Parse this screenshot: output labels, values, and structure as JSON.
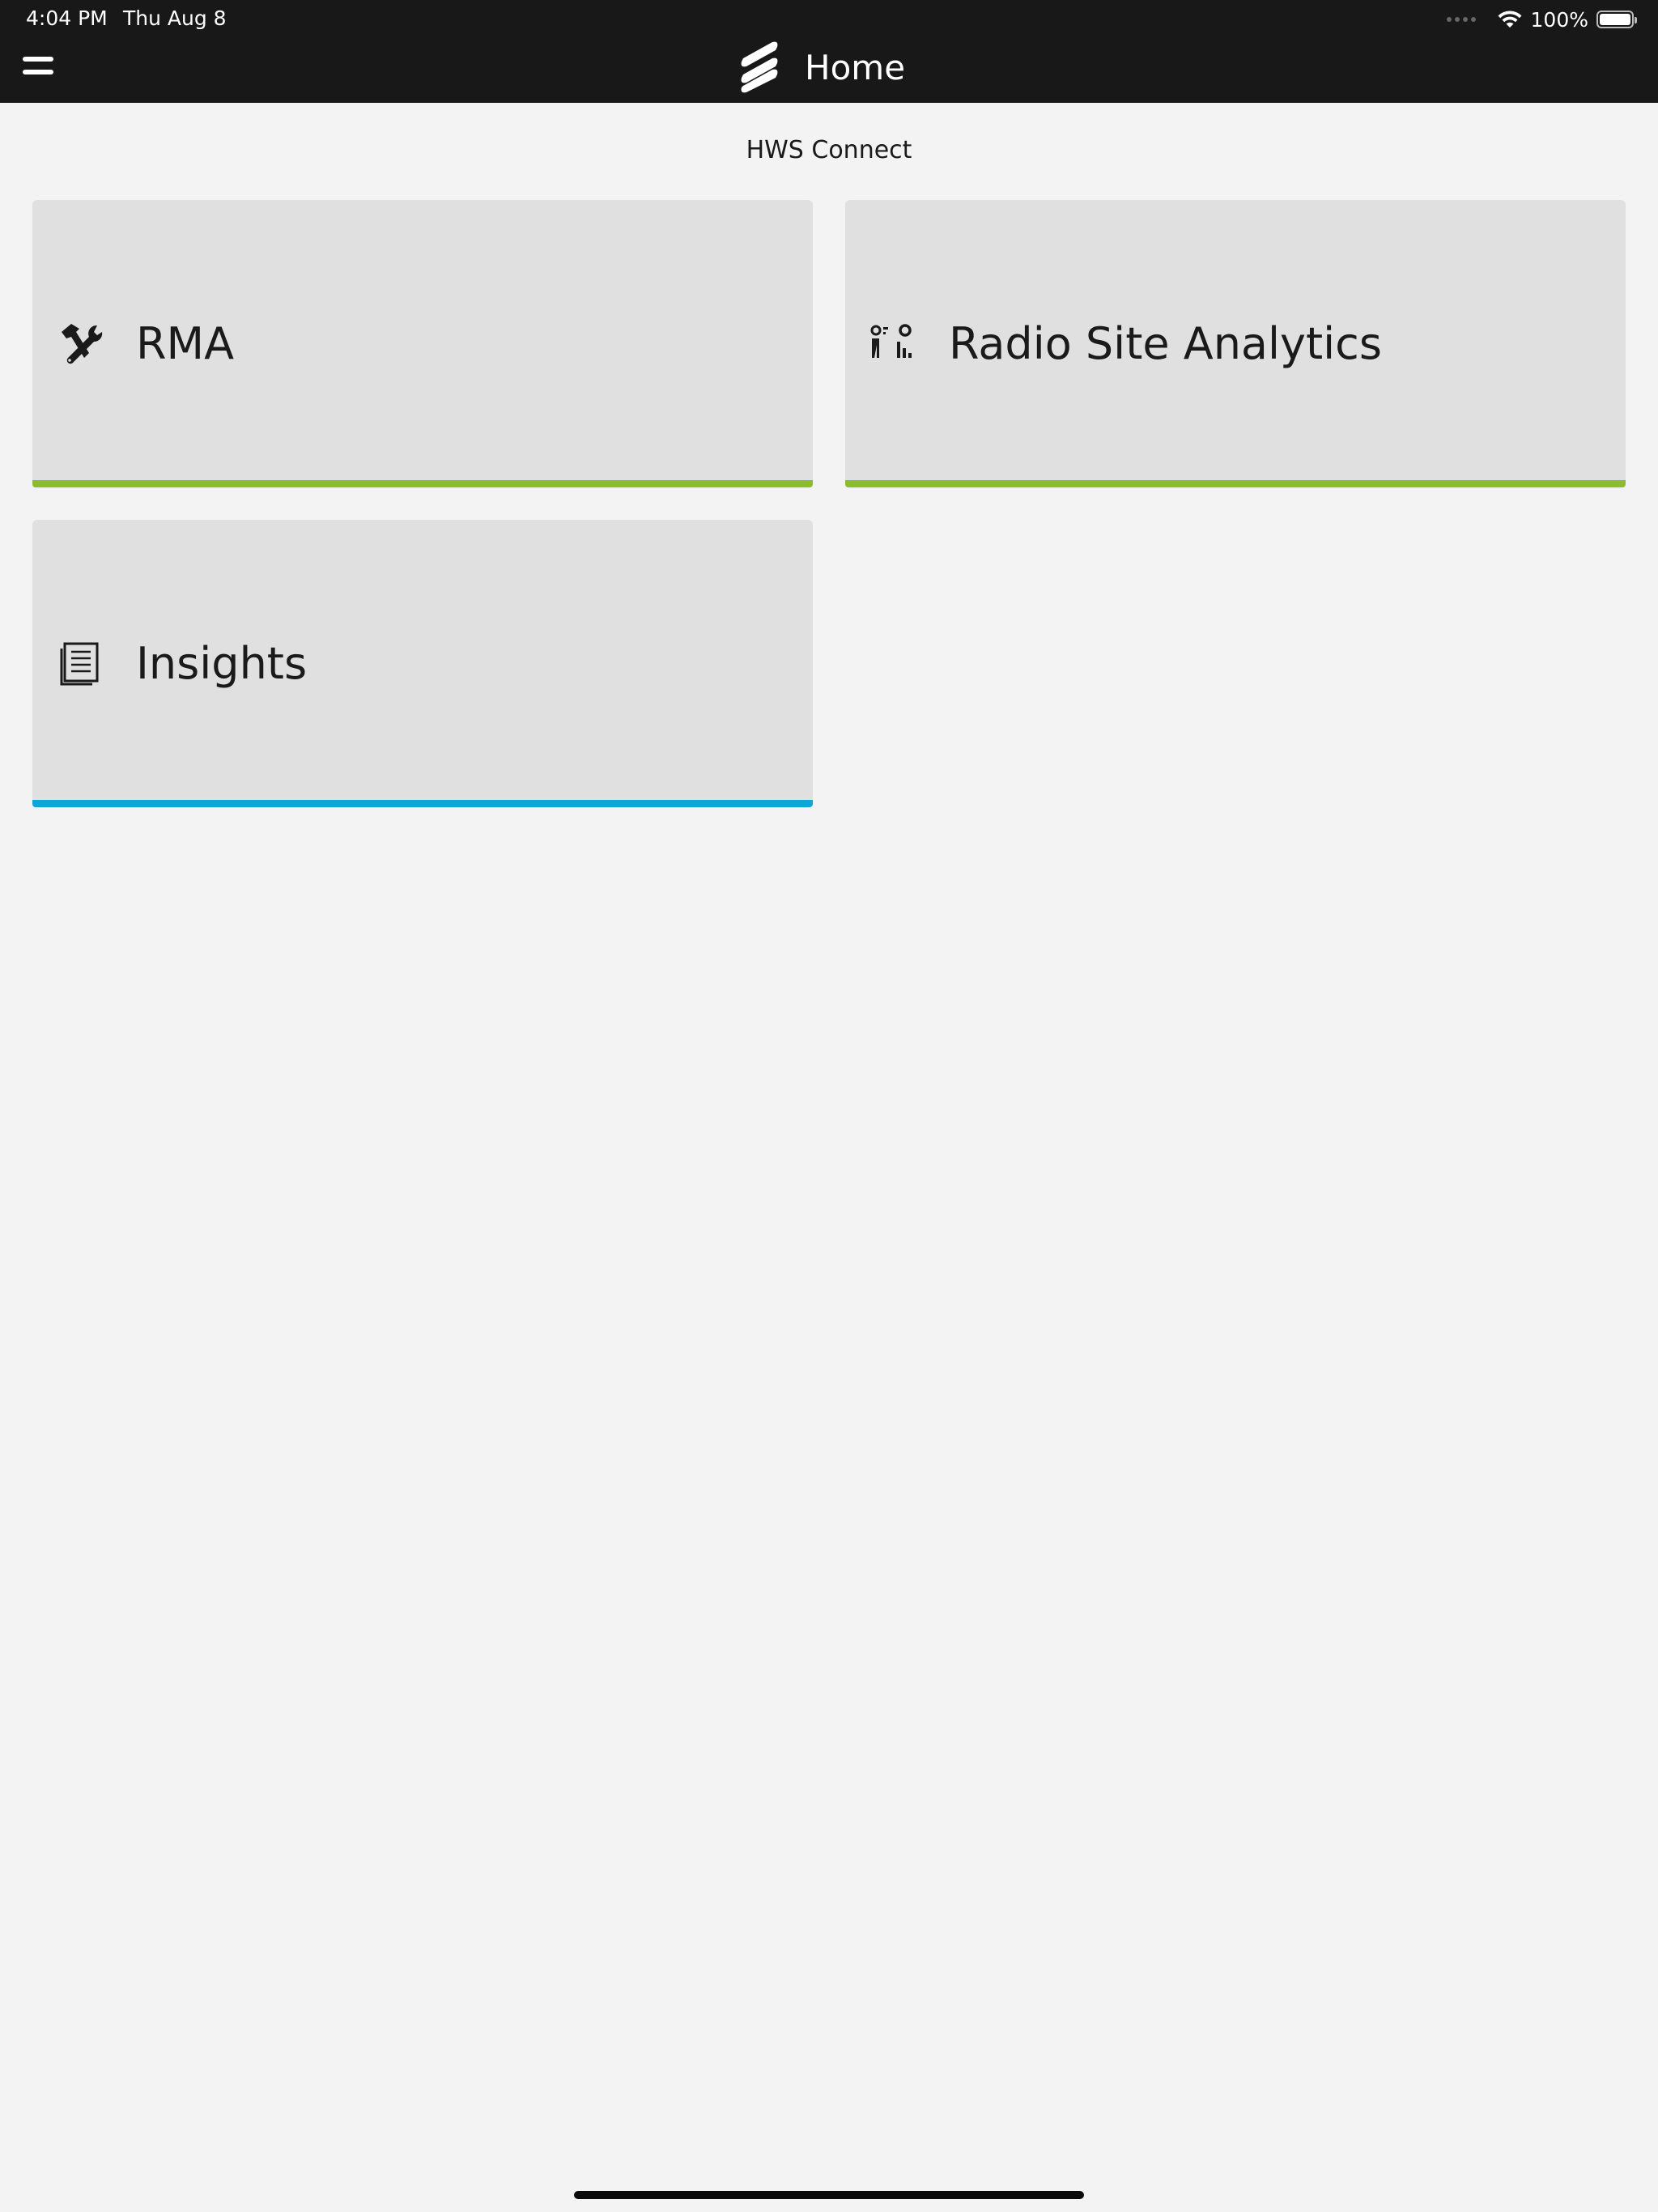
{
  "status_bar": {
    "time": "4:04 PM",
    "date": "Thu Aug 8",
    "battery": "100%"
  },
  "header": {
    "title": "Home",
    "logo_icon": "ericsson-logo-icon",
    "menu_icon": "hamburger-menu-icon"
  },
  "section": {
    "title": "HWS Connect"
  },
  "tiles": [
    {
      "label": "RMA",
      "icon": "tools-icon",
      "accent": "#8cbd2d"
    },
    {
      "label": "Radio Site Analytics",
      "icon": "radio-site-analytics-icon",
      "accent": "#8cbd2d"
    },
    {
      "label": "Insights",
      "icon": "document-icon",
      "accent": "#0ea6d6"
    }
  ],
  "colors": {
    "header_bg": "#181818",
    "page_bg": "#f3f3f3",
    "tile_bg": "#e0e0e0"
  }
}
